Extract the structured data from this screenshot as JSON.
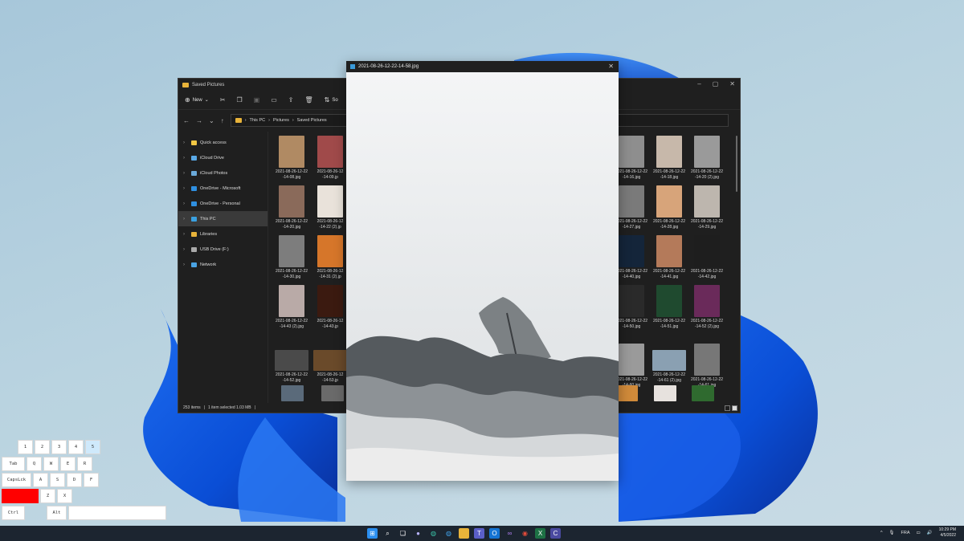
{
  "explorer": {
    "title": "Saved Pictures",
    "toolbar": {
      "new_label": "New",
      "sort_label": "So"
    },
    "address": {
      "segments": [
        "This PC",
        "Pictures",
        "Saved Pictures"
      ]
    },
    "nav": [
      {
        "label": "Quick access",
        "icon": "star-icon",
        "color": "#f2c744"
      },
      {
        "label": "iCloud Drive",
        "icon": "cloud-icon",
        "color": "#5aa9e6"
      },
      {
        "label": "iCloud Photos",
        "icon": "photos-icon",
        "color": "#6aa9d9"
      },
      {
        "label": "OneDrive - Microsoft",
        "icon": "onedrive-icon",
        "color": "#2f8fe0"
      },
      {
        "label": "OneDrive - Personal",
        "icon": "onedrive-icon",
        "color": "#2f8fe0"
      },
      {
        "label": "This PC",
        "icon": "pc-icon",
        "color": "#3aa0e0"
      },
      {
        "label": "Libraries",
        "icon": "library-icon",
        "color": "#e8b33a"
      },
      {
        "label": "USB Drive (F:)",
        "icon": "usb-icon",
        "color": "#aaaaaa"
      },
      {
        "label": "Network",
        "icon": "network-icon",
        "color": "#4aa3e3"
      }
    ],
    "files": [
      {
        "line1": "2021-08-26-12-22",
        "line2": "-14-08.jpg",
        "color": "#b08a63"
      },
      {
        "line1": "2021-08-26-12",
        "line2": "-14-09.jp",
        "color": "#a04a4a"
      },
      {
        "line1": "2021-08-26-12-22",
        "line2": "-14-16.jpg",
        "color": "#8e8e8e"
      },
      {
        "line1": "2021-08-26-12-22",
        "line2": "-14-18.jpg",
        "color": "#c7b8aa"
      },
      {
        "line1": "2021-08-26-12-22",
        "line2": "-14-20 (2).jpg",
        "color": "#9a9a9a"
      },
      {
        "line1": "2021-08-26-12-22",
        "line2": "-14-20.jpg",
        "color": "#8a6a5a"
      },
      {
        "line1": "2021-08-26-12",
        "line2": "-14-22 (2).jp",
        "color": "#e9e2da"
      },
      {
        "line1": "2021-08-26-12-22",
        "line2": "-14-27.jpg",
        "color": "#7a7a7a"
      },
      {
        "line1": "2021-08-26-12-22",
        "line2": "-14-28.jpg",
        "color": "#d7a47a"
      },
      {
        "line1": "2021-08-26-12-22",
        "line2": "-14-29.jpg",
        "color": "#bdb6ae"
      },
      {
        "line1": "2021-08-26-12-22",
        "line2": "-14-30.jpg",
        "color": "#7d7d7d"
      },
      {
        "line1": "2021-08-26-12",
        "line2": "-14-31 (2).jp",
        "color": "#d6762a"
      },
      {
        "line1": "2021-08-26-12-22",
        "line2": "-14-40.jpg",
        "color": "#14253a"
      },
      {
        "line1": "2021-08-26-12-22",
        "line2": "-14-41.jpg",
        "color": "#b47a5a"
      },
      {
        "line1": "2021-08-26-12-22",
        "line2": "-14-42.jpg",
        "color": "#1e1e1e"
      },
      {
        "line1": "2021-08-26-12-22",
        "line2": "-14-43 (2).jpg",
        "color": "#b9aaa7"
      },
      {
        "line1": "2021-08-26-12",
        "line2": "-14-43.jp",
        "color": "#3b1a10"
      },
      {
        "line1": "2021-08-26-12-22",
        "line2": "-14-50.jpg",
        "color": "#2a2a2a"
      },
      {
        "line1": "2021-08-26-12-22",
        "line2": "-14-51.jpg",
        "color": "#1f4a2f"
      },
      {
        "line1": "2021-08-26-12-22",
        "line2": "-14-52 (2).jpg",
        "color": "#6a2a5a"
      },
      {
        "line1": "2021-08-26-12-22",
        "line2": "-14-52.jpg",
        "color": "#4a4a4a"
      },
      {
        "line1": "2021-08-26-12",
        "line2": "-14-53.jp",
        "color": "#6a4a2a"
      },
      {
        "line1": "2021-08-26-12-22",
        "line2": "-14-60.jpg",
        "color": "#9a9a9a"
      },
      {
        "line1": "2021-08-26-12-22",
        "line2": "-14-61 (2).jpg",
        "color": "#8aa0b2"
      },
      {
        "line1": "2021-08-26-12-22",
        "line2": "-14-61.jpg",
        "color": "#777777"
      }
    ],
    "status": {
      "count": "253 items",
      "selected": "1 item selected  1.03 MB"
    }
  },
  "viewer": {
    "title": "2021-08-26-12-22-14-58.jpg"
  },
  "keyboard": {
    "row1": [
      "1",
      "2",
      "3",
      "4",
      "5"
    ],
    "row2": [
      "Tab",
      "Q",
      "W",
      "E",
      "R"
    ],
    "row3": [
      "CapsLck",
      "A",
      "S",
      "D",
      "F"
    ],
    "row4": [
      "Z",
      "X"
    ],
    "row5": [
      "Ctrl",
      "Alt"
    ],
    "highlight_key": "5"
  },
  "taskbar": {
    "language": "FRA",
    "time": "10:29 PM",
    "date": "4/5/2022"
  }
}
